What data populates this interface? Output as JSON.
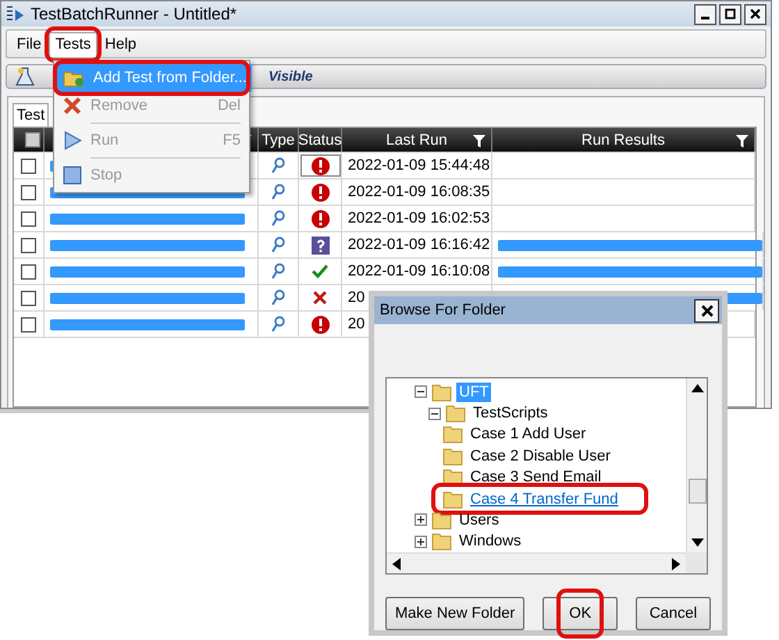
{
  "window": {
    "title": "TestBatchRunner - Untitled*"
  },
  "menu": [
    {
      "label": "File",
      "selected": false,
      "highlighted": false
    },
    {
      "label": "Tests",
      "selected": true,
      "highlighted": true
    },
    {
      "label": "Help",
      "selected": false,
      "highlighted": false
    }
  ],
  "dropdown": [
    {
      "kind": "add",
      "label": "Add Test from Folder...",
      "disabled": false,
      "selected": true,
      "highlighted": true
    },
    {
      "kind": "remove",
      "label": "Remove",
      "shortcut": "Del",
      "disabled": true,
      "selected": false,
      "highlighted": false
    },
    {
      "kind": "run",
      "label": "Run",
      "shortcut": "F5",
      "disabled": true,
      "selected": false,
      "highlighted": false
    },
    {
      "kind": "stop",
      "label": "Stop",
      "disabled": true,
      "selected": false,
      "highlighted": false
    }
  ],
  "toolbar": {
    "label": "Visible"
  },
  "tabs": [
    {
      "label": "Test",
      "selected": true
    }
  ],
  "table": {
    "select_all": {
      "checked": false
    },
    "columns": [
      {
        "label": "Type",
        "filter": false
      },
      {
        "label": "Status",
        "filter": false
      },
      {
        "label": "Last Run",
        "filter": true
      },
      {
        "label": "Run Results",
        "filter": true
      }
    ],
    "rows": [
      {
        "checked": false,
        "kind": "error",
        "last_run": "2022-01-09 15:44:48",
        "has_result": false,
        "selected": true
      },
      {
        "checked": false,
        "kind": "error",
        "last_run": "2022-01-09 16:08:35",
        "has_result": false,
        "selected": false
      },
      {
        "checked": false,
        "kind": "error",
        "last_run": "2022-01-09 16:02:53",
        "has_result": false,
        "selected": false
      },
      {
        "checked": false,
        "kind": "unknown",
        "last_run": "2022-01-09 16:16:42",
        "has_result": true,
        "selected": false
      },
      {
        "checked": false,
        "kind": "passed",
        "last_run": "2022-01-09 16:10:08",
        "has_result": true,
        "selected": false
      },
      {
        "checked": false,
        "kind": "failed",
        "last_run": "20",
        "has_result": true,
        "selected": false
      },
      {
        "checked": false,
        "kind": "error",
        "last_run": "20",
        "has_result": false,
        "selected": false
      }
    ]
  },
  "dialog": {
    "title": "Browse For Folder",
    "tree": [
      {
        "label": "UFT",
        "expanded": true,
        "selected": true,
        "hover": false,
        "highlighted": false,
        "children": [
          {
            "label": "TestScripts",
            "expanded": true,
            "selected": false,
            "hover": false,
            "highlighted": false,
            "children": [
              {
                "label": "Case 1 Add User",
                "selected": false,
                "hover": false,
                "highlighted": false
              },
              {
                "label": "Case 2 Disable User",
                "selected": false,
                "hover": false,
                "highlighted": false
              },
              {
                "label": "Case 3 Send Email",
                "selected": false,
                "hover": false,
                "highlighted": false
              },
              {
                "label": "Case 4 Transfer Fund",
                "selected": false,
                "hover": true,
                "highlighted": true
              }
            ]
          }
        ]
      },
      {
        "label": "Users",
        "expanded": false,
        "selected": false,
        "hover": false,
        "highlighted": false
      },
      {
        "label": "Windows",
        "expanded": false,
        "selected": false,
        "hover": false,
        "highlighted": false
      }
    ],
    "buttons": [
      {
        "label": "Make New Folder",
        "highlighted": false
      },
      {
        "label": "OK",
        "highlighted": true
      },
      {
        "label": "Cancel",
        "highlighted": false
      }
    ]
  }
}
